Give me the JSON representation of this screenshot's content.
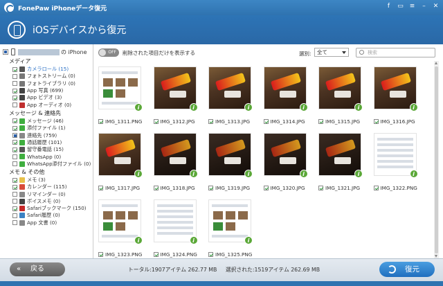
{
  "window": {
    "title": "FonePaw iPhoneデータ復元"
  },
  "header": {
    "title": "iOSデバイスから復元"
  },
  "sidebar": {
    "device_name": "の iPhone",
    "categories": [
      {
        "label": "メディア",
        "items": [
          {
            "label": "カメラロール (15)",
            "icon": "camera-icon",
            "color": "#555",
            "selected": true,
            "check": "checked"
          },
          {
            "label": "フォトストリーム (0)",
            "icon": "photo-stream-icon",
            "color": "#777",
            "check": "none"
          },
          {
            "label": "フォトライブラリ (0)",
            "icon": "photo-library-icon",
            "color": "#777",
            "check": "none"
          },
          {
            "label": "App 写真 (699)",
            "icon": "app-photo-icon",
            "color": "#444",
            "check": "checked"
          },
          {
            "label": "App ビデオ (3)",
            "icon": "app-video-icon",
            "color": "#444",
            "check": "checked"
          },
          {
            "label": "App オーディオ (0)",
            "icon": "app-audio-icon",
            "color": "#c03030",
            "check": "none"
          }
        ]
      },
      {
        "label": "メッセージ & 連絡先",
        "items": [
          {
            "label": "メッセージ (46)",
            "icon": "message-icon",
            "color": "#3fae3f",
            "check": "checked"
          },
          {
            "label": "添付ファイル (1)",
            "icon": "attachment-icon",
            "color": "#3fae3f",
            "check": "checked"
          },
          {
            "label": "連絡先 (759)",
            "icon": "contacts-icon",
            "color": "#888",
            "check": "partial"
          },
          {
            "label": "通話履歴 (101)",
            "icon": "call-history-icon",
            "color": "#3fae3f",
            "check": "checked"
          },
          {
            "label": "留守番電話 (15)",
            "icon": "voicemail-icon",
            "color": "#555",
            "check": "checked"
          },
          {
            "label": "WhatsApp (0)",
            "icon": "whatsapp-icon",
            "color": "#3fae3f",
            "check": "none"
          },
          {
            "label": "WhatsApp添付ファイル (0)",
            "icon": "whatsapp-attachment-icon",
            "color": "#3fae3f",
            "check": "none"
          }
        ]
      },
      {
        "label": "メモ & その他",
        "items": [
          {
            "label": "メモ (3)",
            "icon": "notes-icon",
            "color": "#e8c14a",
            "check": "checked"
          },
          {
            "label": "カレンダー (115)",
            "icon": "calendar-icon",
            "color": "#d84b3a",
            "check": "checked"
          },
          {
            "label": "リマインダー (0)",
            "icon": "reminders-icon",
            "color": "#888",
            "check": "none"
          },
          {
            "label": "ボイスメモ (0)",
            "icon": "voice-memo-icon",
            "color": "#444",
            "check": "none"
          },
          {
            "label": "Safariブックマーク (150)",
            "icon": "safari-bookmark-icon",
            "color": "#c62828",
            "check": "checked"
          },
          {
            "label": "Safari履歴 (0)",
            "icon": "safari-history-icon",
            "color": "#3b82c4",
            "check": "none"
          },
          {
            "label": "App 文書 (0)",
            "icon": "app-document-icon",
            "color": "#888",
            "check": "none"
          }
        ]
      }
    ]
  },
  "toolbar": {
    "toggle_state": "OFF",
    "toggle_label": "削除された項目だけを表示する",
    "filter_label": "選別:",
    "filter_value": "全て",
    "search_placeholder": "検索"
  },
  "files": [
    {
      "name": "IMG_1311.PNG",
      "kind": "shot"
    },
    {
      "name": "IMG_1312.JPG",
      "kind": "photo"
    },
    {
      "name": "IMG_1313.JPG",
      "kind": "photo"
    },
    {
      "name": "IMG_1314.JPG",
      "kind": "photo"
    },
    {
      "name": "IMG_1315.JPG",
      "kind": "photo"
    },
    {
      "name": "IMG_1316.JPG",
      "kind": "photo"
    },
    {
      "name": "IMG_1317.JPG",
      "kind": "photo"
    },
    {
      "name": "IMG_1318.JPG",
      "kind": "dark"
    },
    {
      "name": "IMG_1319.JPG",
      "kind": "dark"
    },
    {
      "name": "IMG_1320.JPG",
      "kind": "dark"
    },
    {
      "name": "IMG_1321.JPG",
      "kind": "dark"
    },
    {
      "name": "IMG_1322.PNG",
      "kind": "shot"
    },
    {
      "name": "IMG_1323.PNG",
      "kind": "shot"
    },
    {
      "name": "IMG_1324.PNG",
      "kind": "shot"
    },
    {
      "name": "IMG_1325.PNG",
      "kind": "shot"
    }
  ],
  "footer": {
    "back_label": "戻る",
    "total": "トータル:1907アイテム 262.77 MB",
    "selected": "選択された:1519アイテム 262.69 MB",
    "recover_label": "復元"
  }
}
